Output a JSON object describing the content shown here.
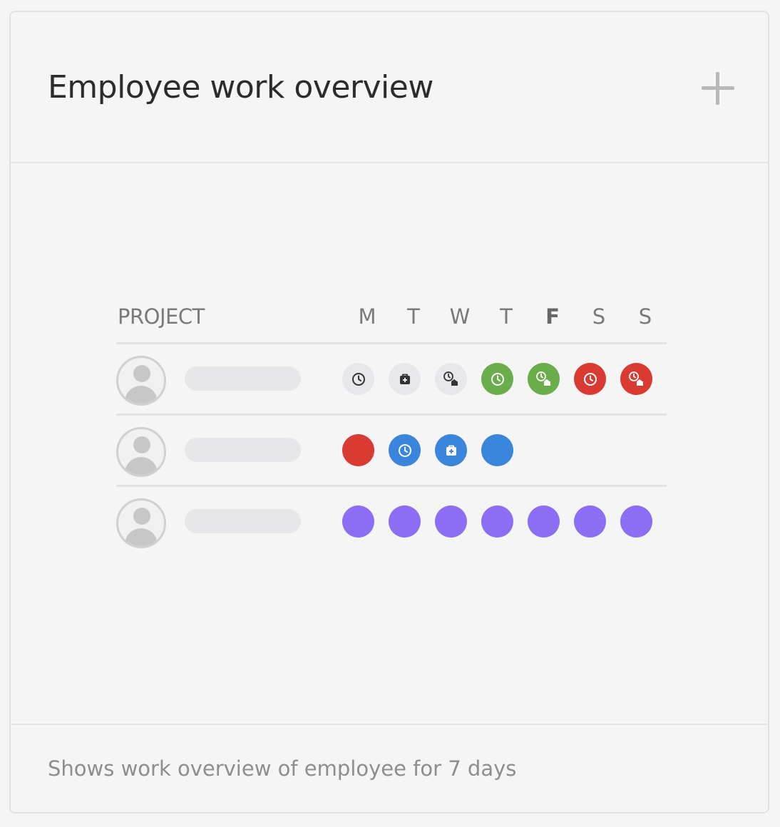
{
  "widget": {
    "title": "Employee work overview",
    "add_icon": "plus-icon",
    "footer": "Shows work overview of employee for 7 days"
  },
  "table": {
    "project_header": "PROJECT",
    "days": [
      "M",
      "T",
      "W",
      "T",
      "F",
      "S",
      "S"
    ],
    "today_index": 4,
    "rows": [
      {
        "statuses": [
          {
            "color": "#e8e8ec",
            "icon": "clock-icon"
          },
          {
            "color": "#e8e8ec",
            "icon": "medical-kit-icon"
          },
          {
            "color": "#e8e8ec",
            "icon": "clock-home-icon"
          },
          {
            "color": "#6aad4b",
            "icon": "clock-icon"
          },
          {
            "color": "#6aad4b",
            "icon": "clock-home-icon"
          },
          {
            "color": "#d93a32",
            "icon": "clock-icon"
          },
          {
            "color": "#d93a32",
            "icon": "clock-home-icon"
          }
        ]
      },
      {
        "statuses": [
          {
            "color": "#d93a32",
            "icon": ""
          },
          {
            "color": "#3a86dc",
            "icon": "clock-icon"
          },
          {
            "color": "#3a86dc",
            "icon": "medical-kit-icon"
          },
          {
            "color": "#3a86dc",
            "icon": ""
          }
        ]
      },
      {
        "statuses": [
          {
            "color": "#8b6ef4",
            "icon": ""
          },
          {
            "color": "#8b6ef4",
            "icon": ""
          },
          {
            "color": "#8b6ef4",
            "icon": ""
          },
          {
            "color": "#8b6ef4",
            "icon": ""
          },
          {
            "color": "#8b6ef4",
            "icon": ""
          },
          {
            "color": "#8b6ef4",
            "icon": ""
          },
          {
            "color": "#8b6ef4",
            "icon": ""
          }
        ]
      }
    ]
  }
}
